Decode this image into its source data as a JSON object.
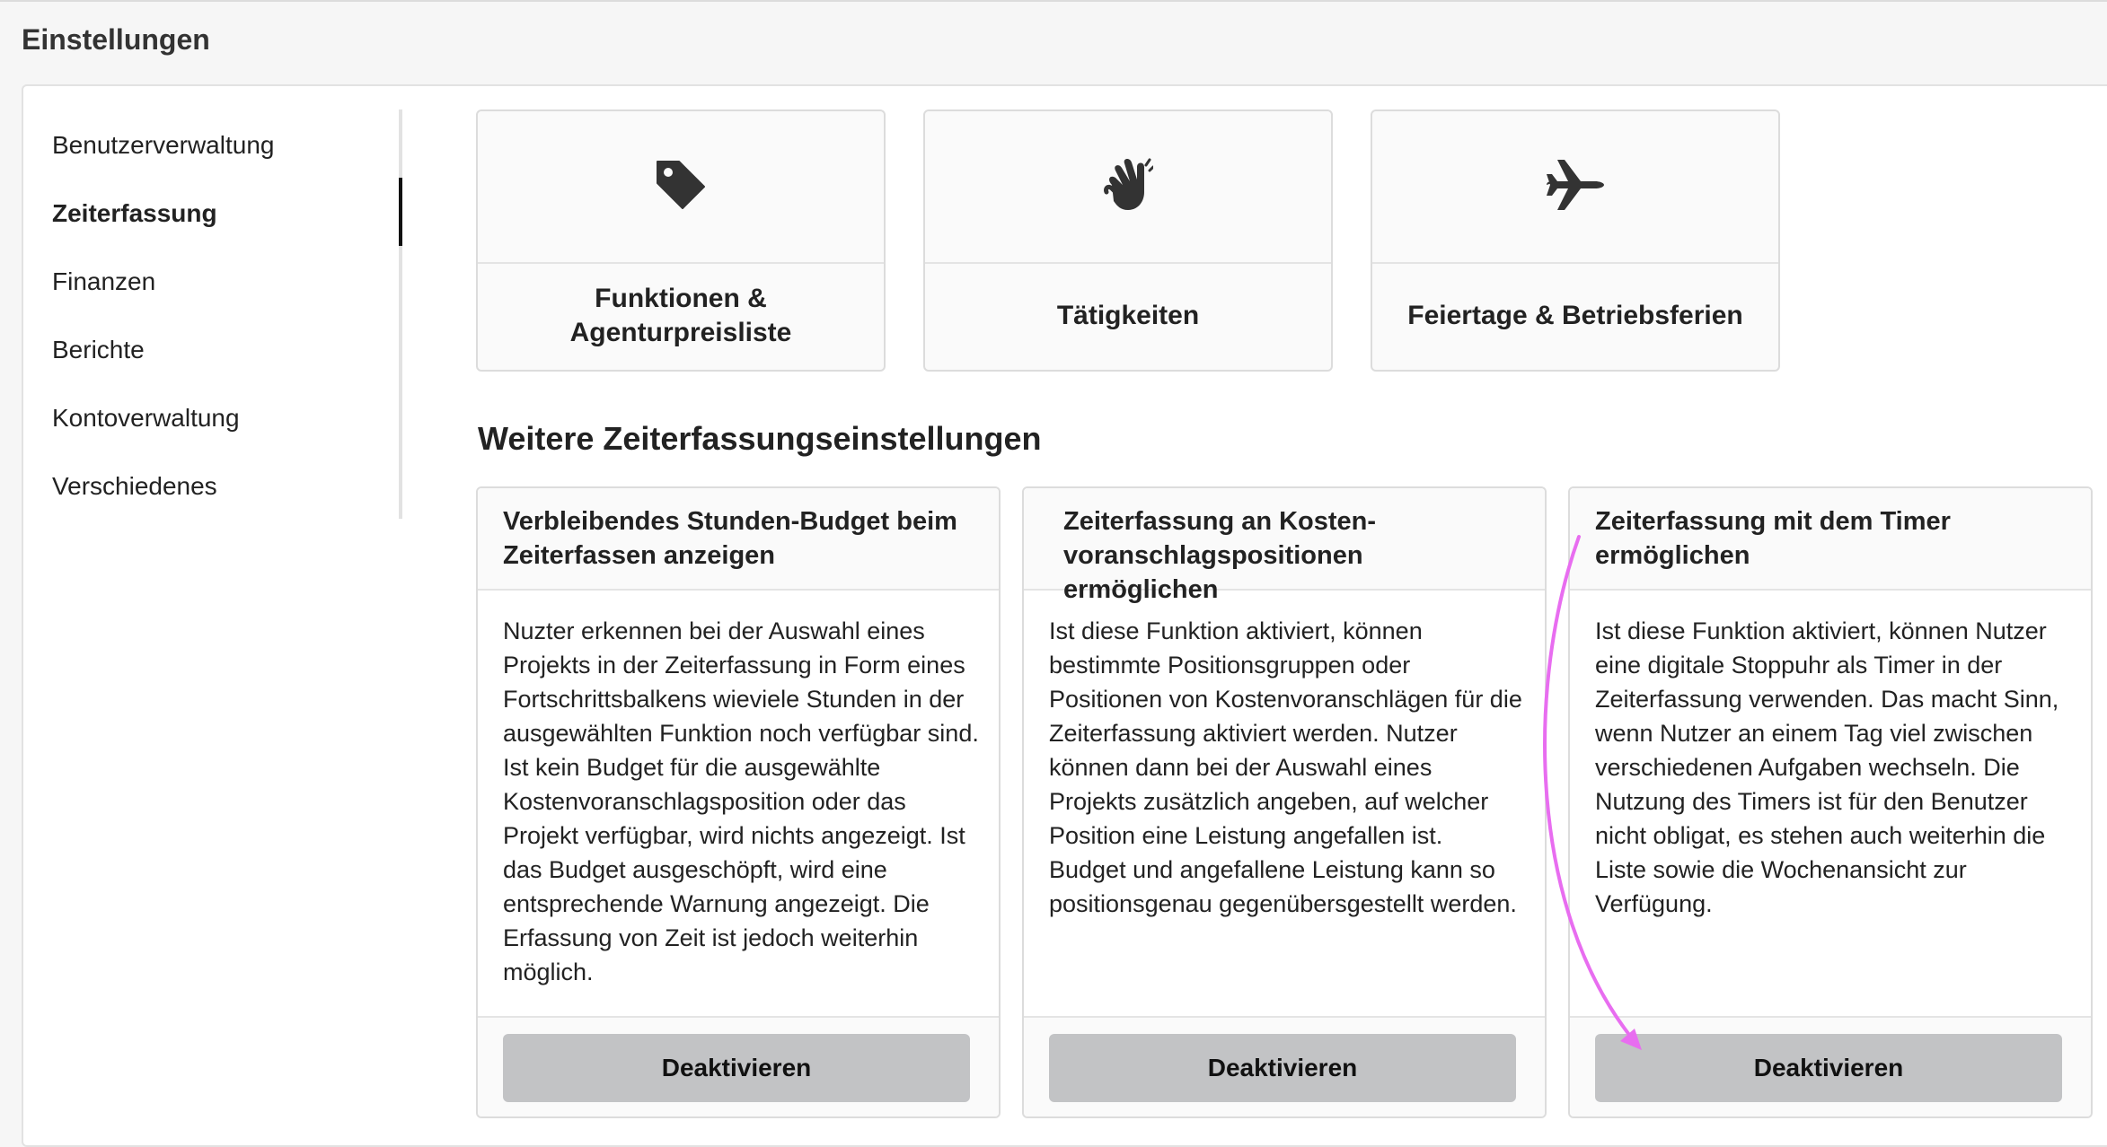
{
  "page": {
    "title": "Einstellungen"
  },
  "sidebar": {
    "items": [
      {
        "label": "Benutzerverwaltung"
      },
      {
        "label": "Zeiterfassung",
        "active": true
      },
      {
        "label": "Finanzen"
      },
      {
        "label": "Berichte"
      },
      {
        "label": "Kontoverwaltung"
      },
      {
        "label": "Verschiedenes"
      }
    ]
  },
  "icon_cards": [
    {
      "icon": "tag-icon",
      "label": "Funktionen & Agenturpreisliste"
    },
    {
      "icon": "hands-clapping-icon",
      "label": "Tätigkeiten"
    },
    {
      "icon": "plane-icon",
      "label": "Feiertage & Betriebsferien"
    }
  ],
  "section": {
    "heading": "Weitere Zeiterfassungseinstellungen"
  },
  "settings": [
    {
      "title": "Verbleibendes Stunden-Budget beim Zeiterfassen anzeigen",
      "description": "Nuzter erkennen bei der Auswahl eines Projekts in der Zeiterfassung in Form eines Fortschrittsbalkens wieviele Stunden in der ausgewählten Funktion noch verfügbar sind. Ist kein Budget für die ausgewählte Kostenvoranschlagsposition oder das Projekt verfügbar, wird nichts angezeigt. Ist das Budget ausgeschöpft, wird eine entsprechende Warnung angezeigt. Die Erfassung von Zeit ist jedoch weiterhin möglich.",
      "button": "Deaktivieren"
    },
    {
      "title": "Zeiterfassung an Kosten-voranschlagspositionen ermöglichen",
      "description": "Ist diese Funktion aktiviert, können bestimmte Positionsgruppen oder Positionen von Kostenvoranschlägen für die Zeiterfassung aktiviert werden. Nutzer können dann bei der Auswahl eines Projekts zusätzlich angeben, auf welcher Position eine Leistung angefallen ist. Budget und angefallene Leistung kann so positionsgenau gegenübersgestellt werden.",
      "button": "Deaktivieren"
    },
    {
      "title": "Zeiterfassung mit dem Timer ermöglichen",
      "description": "Ist diese Funktion aktiviert, können Nutzer eine digitale Stoppuhr als Timer in der Zeiterfassung verwenden. Das macht Sinn, wenn Nutzer an einem Tag viel zwischen verschiedenen Aufgaben wechseln. Die Nutzung des Timers ist für den Benutzer nicht obligat, es stehen auch weiterhin die Liste sowie die Wochenansicht zur Verfügung.",
      "button": "Deaktivieren"
    }
  ],
  "annotation": {
    "arrow_color": "#e86df0"
  }
}
